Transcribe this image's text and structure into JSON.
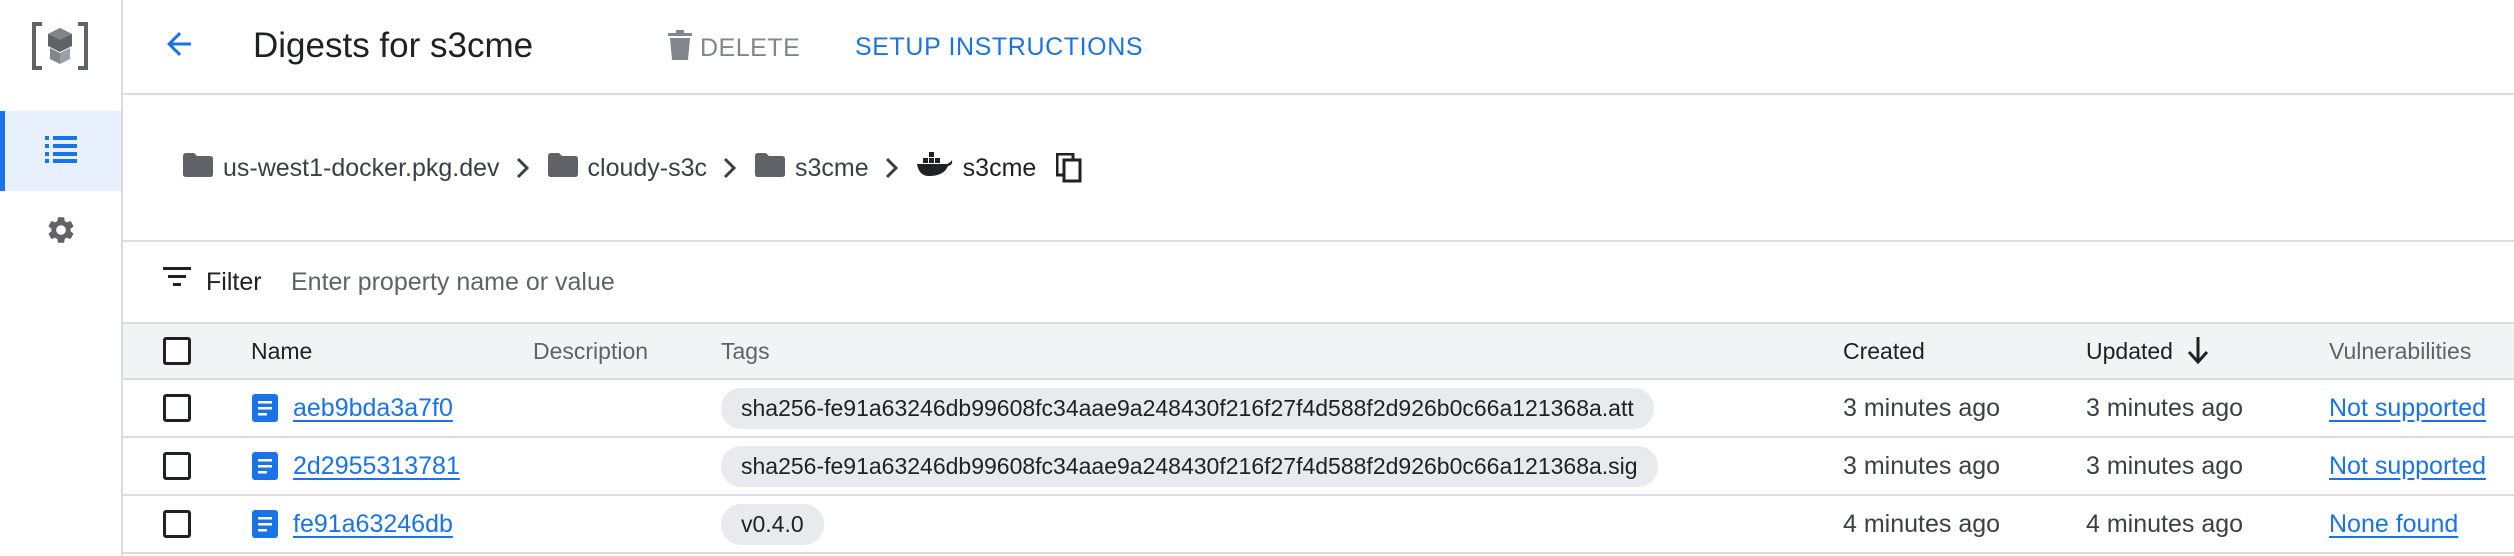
{
  "header": {
    "title": "Digests for s3cme",
    "delete_label": "DELETE",
    "setup_label": "SETUP INSTRUCTIONS"
  },
  "breadcrumb": [
    {
      "label": "us-west1-docker.pkg.dev",
      "icon": "folder-icon"
    },
    {
      "label": "cloudy-s3c",
      "icon": "folder-icon"
    },
    {
      "label": "s3cme",
      "icon": "folder-icon"
    },
    {
      "label": "s3cme",
      "icon": "docker-icon"
    }
  ],
  "filter": {
    "label": "Filter",
    "placeholder": "Enter property name or value"
  },
  "table": {
    "columns": {
      "name": "Name",
      "description": "Description",
      "tags": "Tags",
      "created": "Created",
      "updated": "Updated",
      "vulnerabilities": "Vulnerabilities"
    },
    "rows": [
      {
        "name": "aeb9bda3a7f0",
        "description": "",
        "tag": "sha256-fe91a63246db99608fc34aae9a248430f216f27f4d588f2d926b0c66a121368a.att",
        "created": "3 minutes ago",
        "updated": "3 minutes ago",
        "vulnerabilities": "Not supported"
      },
      {
        "name": "2d2955313781",
        "description": "",
        "tag": "sha256-fe91a63246db99608fc34aae9a248430f216f27f4d588f2d926b0c66a121368a.sig",
        "created": "3 minutes ago",
        "updated": "3 minutes ago",
        "vulnerabilities": "Not supported"
      },
      {
        "name": "fe91a63246db",
        "description": "",
        "tag": "v0.4.0",
        "created": "4 minutes ago",
        "updated": "4 minutes ago",
        "vulnerabilities": "None found"
      }
    ]
  },
  "colors": {
    "accent": "#1a73e8",
    "rail_active_bg": "#e8f0fe",
    "header_bg": "#f1f3f4"
  }
}
